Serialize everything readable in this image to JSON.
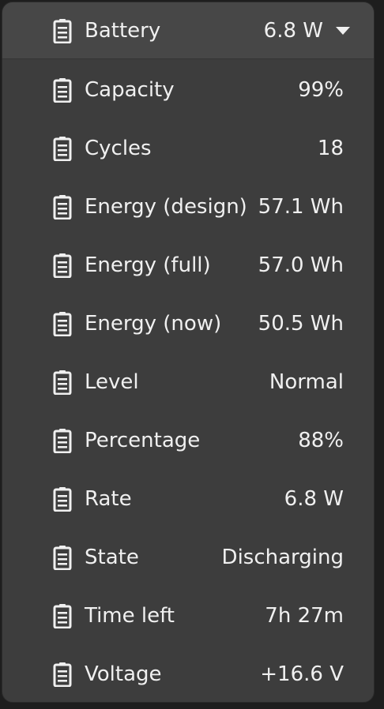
{
  "header": {
    "label": "Battery",
    "value": "6.8 W",
    "icon": "battery-icon",
    "chevron": "chevron-down-icon"
  },
  "items": [
    {
      "label": "Capacity",
      "value": "99%"
    },
    {
      "label": "Cycles",
      "value": "18"
    },
    {
      "label": "Energy (design)",
      "value": "57.1 Wh"
    },
    {
      "label": "Energy (full)",
      "value": "57.0 Wh"
    },
    {
      "label": "Energy (now)",
      "value": "50.5 Wh"
    },
    {
      "label": "Level",
      "value": "Normal"
    },
    {
      "label": "Percentage",
      "value": "88%"
    },
    {
      "label": "Rate",
      "value": "6.8 W"
    },
    {
      "label": "State",
      "value": "Discharging"
    },
    {
      "label": "Time left",
      "value": "7h 27m"
    },
    {
      "label": "Voltage",
      "value": "+16.6 V"
    }
  ],
  "colors": {
    "background": "#3d3d3d",
    "header_background": "#474747",
    "text": "#f0f0f0"
  }
}
